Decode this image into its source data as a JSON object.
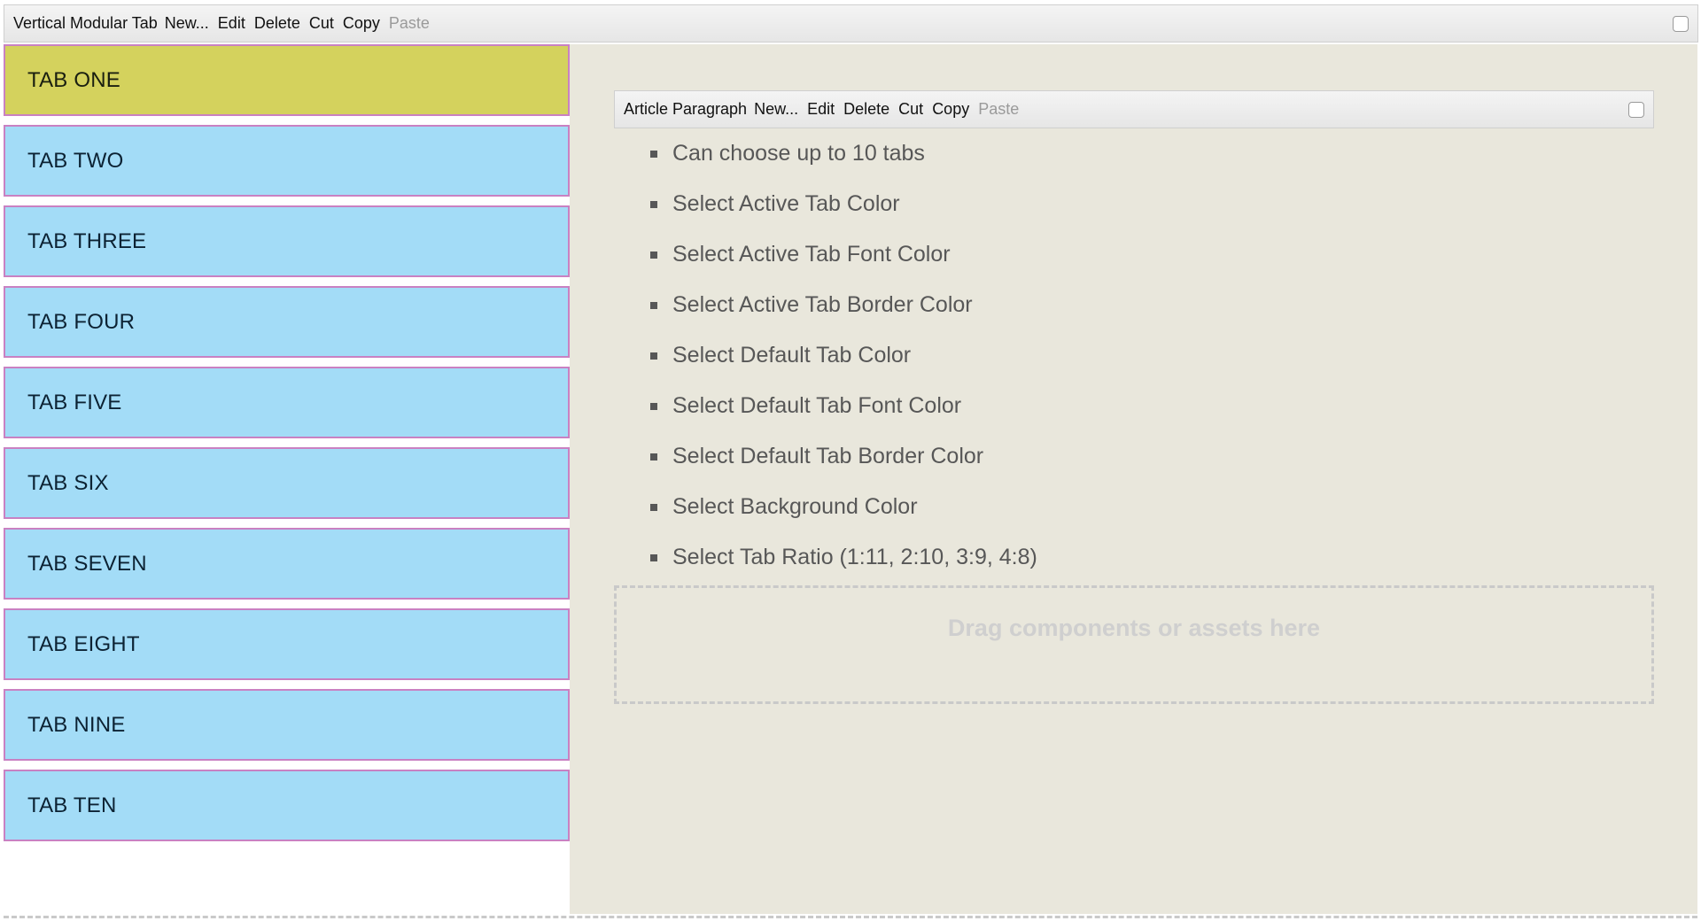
{
  "outer_toolbar": {
    "title": "Vertical Modular Tab",
    "buttons": [
      "New...",
      "Edit",
      "Delete",
      "Cut",
      "Copy",
      "Paste"
    ],
    "disabled": [
      "Paste"
    ]
  },
  "tabs": [
    {
      "label": "TAB ONE",
      "active": true
    },
    {
      "label": "TAB TWO",
      "active": false
    },
    {
      "label": "TAB THREE",
      "active": false
    },
    {
      "label": "TAB FOUR",
      "active": false
    },
    {
      "label": "TAB FIVE",
      "active": false
    },
    {
      "label": "TAB SIX",
      "active": false
    },
    {
      "label": "TAB SEVEN",
      "active": false
    },
    {
      "label": "TAB EIGHT",
      "active": false
    },
    {
      "label": "TAB NINE",
      "active": false
    },
    {
      "label": "TAB TEN",
      "active": false
    }
  ],
  "inner_toolbar": {
    "title": "Article Paragraph",
    "buttons": [
      "New...",
      "Edit",
      "Delete",
      "Cut",
      "Copy",
      "Paste"
    ],
    "disabled": [
      "Paste"
    ]
  },
  "features": [
    "Can choose up to 10 tabs",
    "Select Active Tab Color",
    "Select Active Tab Font Color",
    "Select Active Tab Border Color",
    "Select Default Tab Color",
    "Select Default Tab Font Color",
    "Select Default Tab Border Color",
    "Select Background Color",
    "Select Tab Ratio (1:11, 2:10, 3:9, 4:8)"
  ],
  "drop_zone": {
    "text": "Drag components or assets here"
  },
  "colors": {
    "active_tab_bg": "#d4d25d",
    "default_tab_bg": "#a3dcf7",
    "tab_border": "#c981c2",
    "panel_bg": "#e9e7dc"
  },
  "icons": {
    "toolbar_checkbox": "checkbox-icon",
    "list_bullet": "square-bullet-icon"
  }
}
